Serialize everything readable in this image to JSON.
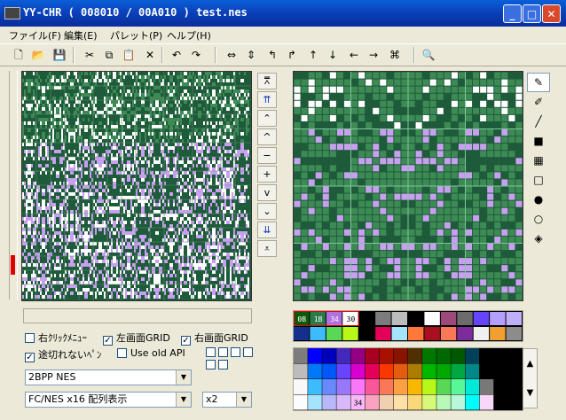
{
  "window": {
    "title": "YY-CHR ( 008010 / 00A010 )  test.nes",
    "min_label": "_",
    "max_label": "□",
    "close_label": "✕"
  },
  "menu": [
    {
      "label": "ファイル(F)"
    },
    {
      "label": "編集(E)"
    },
    {
      "label": "パレット(P)"
    },
    {
      "label": "ヘルプ(H)"
    }
  ],
  "toolbar": {
    "icons": [
      {
        "name": "new-file-icon",
        "glyph": "🗋"
      },
      {
        "name": "open-folder-icon",
        "glyph": "📂"
      },
      {
        "name": "save-icon",
        "glyph": "💾"
      },
      {
        "name": "cut-icon",
        "glyph": "✂"
      },
      {
        "name": "copy-icon",
        "glyph": "⧉"
      },
      {
        "name": "paste-icon",
        "glyph": "📋"
      },
      {
        "name": "delete-icon",
        "glyph": "✕"
      },
      {
        "name": "undo-icon",
        "glyph": "↶"
      },
      {
        "name": "redo-icon",
        "glyph": "↷"
      },
      {
        "name": "flip-horizontal-icon",
        "glyph": "⇔"
      },
      {
        "name": "flip-vertical-icon",
        "glyph": "⇕"
      },
      {
        "name": "rotate-left-icon",
        "glyph": "↰"
      },
      {
        "name": "rotate-right-icon",
        "glyph": "↱"
      },
      {
        "name": "shift-up-icon",
        "glyph": "↑"
      },
      {
        "name": "shift-down-icon",
        "glyph": "↓"
      },
      {
        "name": "shift-left-icon",
        "glyph": "←"
      },
      {
        "name": "shift-right-icon",
        "glyph": "→"
      },
      {
        "name": "replace-color-icon",
        "glyph": "⌘"
      },
      {
        "name": "property-icon",
        "glyph": "🔍"
      }
    ]
  },
  "nav_buttons": [
    {
      "name": "nav-top-button",
      "glyph": "⩞",
      "blue": false
    },
    {
      "name": "nav-page-up-fast-button",
      "glyph": "⇈",
      "blue": true
    },
    {
      "name": "nav-page-up-button",
      "glyph": "⌃",
      "blue": false
    },
    {
      "name": "nav-line-up-button",
      "glyph": "^",
      "blue": false
    },
    {
      "name": "nav-minus-button",
      "glyph": "−",
      "blue": false
    },
    {
      "name": "nav-plus-button",
      "glyph": "+",
      "blue": false
    },
    {
      "name": "nav-line-down-button",
      "glyph": "v",
      "blue": false
    },
    {
      "name": "nav-page-down-button",
      "glyph": "⌄",
      "blue": false
    },
    {
      "name": "nav-page-down-fast-button",
      "glyph": "⇊",
      "blue": true
    },
    {
      "name": "nav-bottom-button",
      "glyph": "⩡",
      "blue": false
    }
  ],
  "tools": [
    {
      "name": "pencil-icon",
      "glyph": "✎",
      "selected": true
    },
    {
      "name": "pen-icon",
      "glyph": "✐",
      "selected": false
    },
    {
      "name": "line-icon",
      "glyph": "╱",
      "selected": false
    },
    {
      "name": "filled-rect-icon",
      "glyph": "■",
      "selected": false
    },
    {
      "name": "pattern-rect-icon",
      "glyph": "▦",
      "selected": false
    },
    {
      "name": "rect-icon",
      "glyph": "□",
      "selected": false
    },
    {
      "name": "filled-circle-icon",
      "glyph": "●",
      "selected": false
    },
    {
      "name": "circle-icon",
      "glyph": "○",
      "selected": false
    },
    {
      "name": "fill-bucket-icon",
      "glyph": "◈",
      "selected": false
    }
  ],
  "options": {
    "right_click_menu": {
      "label": "右ｸﾘｯｸﾒﾆｭｰ",
      "checked": false
    },
    "left_grid": {
      "label": "左画面GRID",
      "checked": true
    },
    "right_grid": {
      "label": "右画面GRID",
      "checked": true
    },
    "seamless_pen": {
      "label": "途切れないﾍﾟﾝ",
      "checked": true
    },
    "old_api": {
      "label": "Use old API",
      "checked": false
    }
  },
  "selects": {
    "format": "2BPP NES",
    "pattern": "FC/NES x16 配列表示",
    "zoom": "x2"
  },
  "palette_strip": {
    "labels": [
      "0B",
      "1B",
      "34",
      "30"
    ],
    "top_row": [
      "#0a5a0a",
      "#2a7a4a",
      "#b070e0",
      "#ffffff",
      "#000000",
      "#7c7c7c",
      "#bcbcbc",
      "#000000",
      "#fcfcfc",
      "#9c4a7c",
      "#6c6c6c",
      "#6644fc",
      "#b4a0fc",
      "#c0b0fc"
    ],
    "bottom_row": [
      "#14308c",
      "#3cbcfc",
      "#58d854",
      "#b8f818",
      "#000000",
      "#e40058",
      "#a4e4fc",
      "#ff7a3a",
      "#a81020",
      "#f87858",
      "#7c2c9c",
      "#f0f0f0",
      "#f0a030",
      "#8c8c8c"
    ]
  },
  "big_palette": {
    "highlight": "34",
    "rows": [
      [
        "#7c7c7c",
        "#0000fc",
        "#0000bc",
        "#4428bc",
        "#940084",
        "#a80020",
        "#a81000",
        "#881400",
        "#503000",
        "#007800",
        "#006800",
        "#005800",
        "#004058",
        "#000000",
        "#000000",
        "#000000"
      ],
      [
        "#bcbcbc",
        "#0078f8",
        "#0058f8",
        "#6844fc",
        "#d800cc",
        "#e40058",
        "#f83800",
        "#e45c10",
        "#ac7c00",
        "#00b800",
        "#00a800",
        "#00a844",
        "#008888",
        "#000000",
        "#000000",
        "#000000"
      ],
      [
        "#f8f8f8",
        "#3cbcfc",
        "#6888fc",
        "#9878f8",
        "#f878f8",
        "#f85898",
        "#f87858",
        "#fca044",
        "#f8b800",
        "#b8f818",
        "#58d854",
        "#58f898",
        "#00e8d8",
        "#787878",
        "#000000",
        "#000000"
      ],
      [
        "#fcfcfc",
        "#a4e4fc",
        "#b8b8f8",
        "#d8b8f8",
        "#f8b8f8",
        "#f8a4c0",
        "#f0d0b0",
        "#fce0a8",
        "#f8d878",
        "#d8f878",
        "#b8f8b8",
        "#b8f8d8",
        "#00fcfc",
        "#f8d8f8",
        "#000000",
        "#000000"
      ]
    ]
  }
}
